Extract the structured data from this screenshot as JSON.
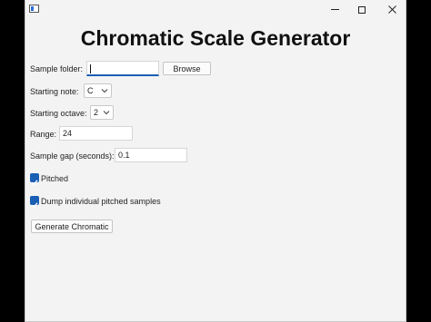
{
  "window": {
    "title": "Chromatic Scale Generator",
    "icons": {
      "app": "app-window-icon",
      "minimize": "minimize-icon",
      "maximize": "maximize-icon",
      "close": "close-icon"
    }
  },
  "form": {
    "sample_folder": {
      "label": "Sample folder:",
      "value": "",
      "browse_label": "Browse"
    },
    "starting_note": {
      "label": "Starting note:",
      "value": "C"
    },
    "starting_octave": {
      "label": "Starting octave:",
      "value": "2"
    },
    "range": {
      "label": "Range:",
      "value": "24"
    },
    "sample_gap": {
      "label": "Sample gap (seconds):",
      "value": "0.1"
    },
    "pitched": {
      "label": "Pitched",
      "checked": true
    },
    "dump_samples": {
      "label": "Dump individual pitched samples",
      "checked": true
    },
    "generate_label": "Generate Chromatic"
  },
  "colors": {
    "accent": "#1a5fb4",
    "window_bg": "#f3f3f3",
    "backdrop": "#000000"
  }
}
